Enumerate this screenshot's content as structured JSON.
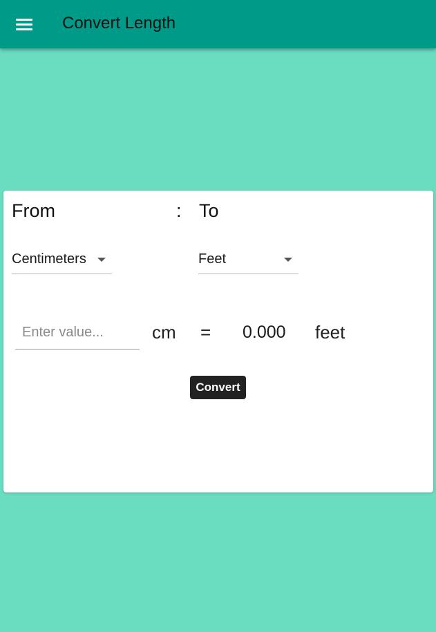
{
  "appbar": {
    "menu_icon": "menu-icon",
    "title": "Convert Length"
  },
  "converter": {
    "from_label": "From",
    "separator": ":",
    "to_label": "To",
    "from_unit_select": {
      "selected": "Centimeters",
      "icon": "caret-down-icon"
    },
    "to_unit_select": {
      "selected": "Feet",
      "icon": "caret-down-icon"
    },
    "input": {
      "value": "",
      "placeholder": "Enter value..."
    },
    "from_unit_abbr": "cm",
    "equals": "=",
    "result": "0.000",
    "to_unit_abbr": "feet",
    "convert_label": "Convert"
  },
  "colors": {
    "appbar": "#009b88",
    "background": "#6adcc0",
    "card": "#ffffff",
    "button": "#222222"
  }
}
